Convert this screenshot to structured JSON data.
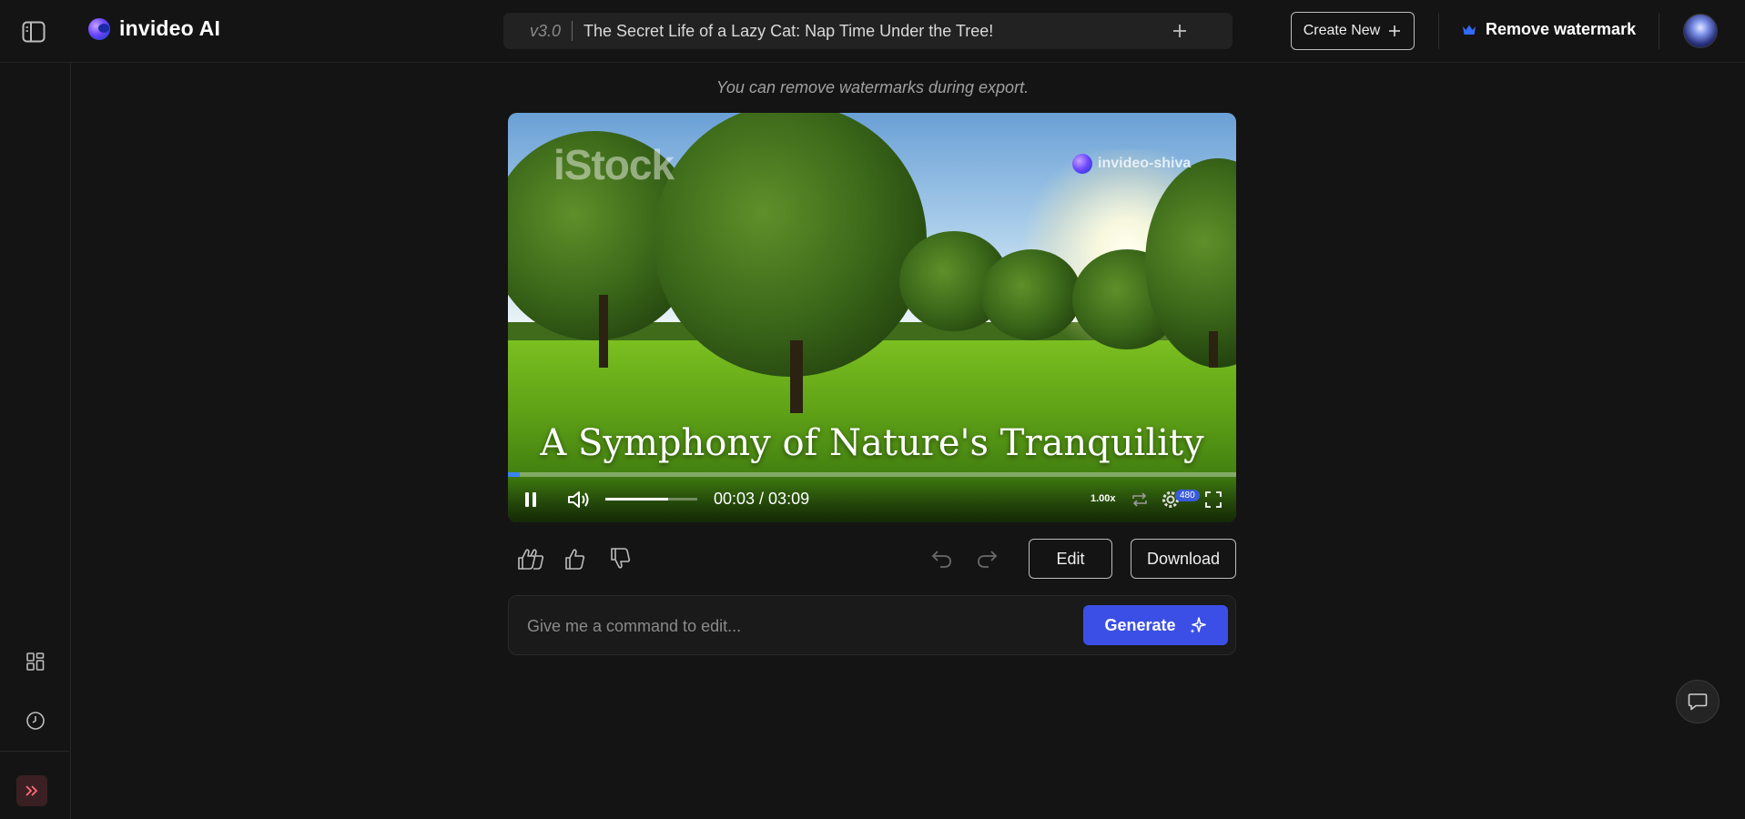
{
  "header": {
    "brand_name": "invideo AI",
    "version": "v3.0",
    "project_title": "The Secret Life of a Lazy Cat: Nap Time Under the Tree!",
    "create_new_label": "Create New",
    "remove_watermark_label": "Remove watermark"
  },
  "notice": "You can remove watermarks during export.",
  "player": {
    "stock_watermark": "iStock",
    "user_watermark": "invideo-shiva",
    "caption": "A Symphony of Nature's Tranquility",
    "current_time": "00:03",
    "duration": "03:09",
    "time_display": "00:03 / 03:09",
    "playback_rate": "1.00x",
    "quality": "480",
    "progress_fraction": 0.016,
    "volume_fraction": 0.68
  },
  "actions": {
    "edit_label": "Edit",
    "download_label": "Download"
  },
  "command": {
    "placeholder": "Give me a command to edit...",
    "generate_label": "Generate"
  },
  "colors": {
    "accent": "#3b4fe6",
    "progress": "#3b82f6",
    "crown": "#2f6bff",
    "background": "#141414"
  }
}
